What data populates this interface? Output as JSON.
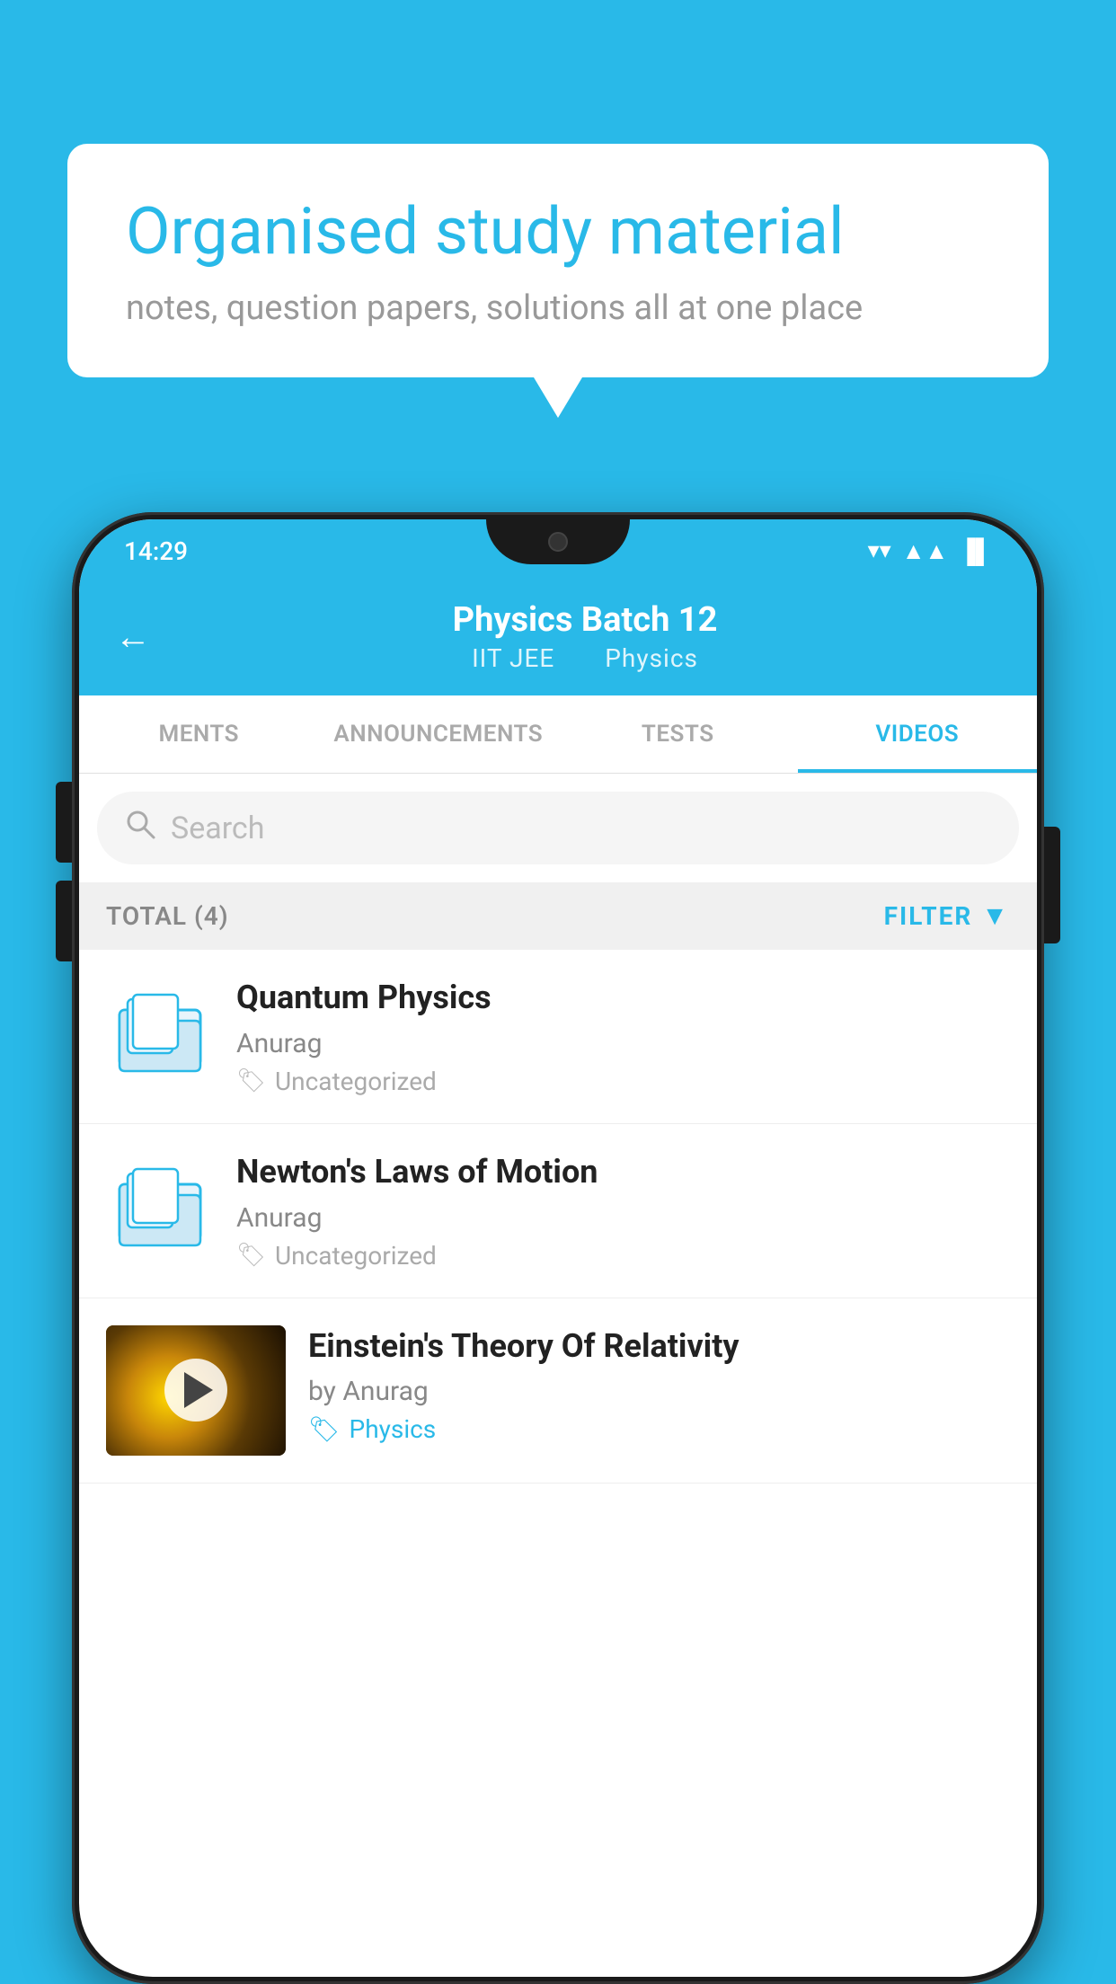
{
  "background_color": "#29b9e8",
  "bubble": {
    "title": "Organised study material",
    "subtitle": "notes, question papers, solutions all at one place"
  },
  "status_bar": {
    "time": "14:29",
    "wifi_icon": "▼",
    "signal_icon": "▲",
    "battery_icon": "▐"
  },
  "app_bar": {
    "title": "Physics Batch 12",
    "subtitle_left": "IIT JEE",
    "subtitle_right": "Physics",
    "back_label": "←"
  },
  "tabs": [
    {
      "id": "ments",
      "label": "MENTS",
      "active": false
    },
    {
      "id": "announcements",
      "label": "ANNOUNCEMENTS",
      "active": false
    },
    {
      "id": "tests",
      "label": "TESTS",
      "active": false
    },
    {
      "id": "videos",
      "label": "VIDEOS",
      "active": true
    }
  ],
  "search": {
    "placeholder": "Search"
  },
  "filter_bar": {
    "total_label": "TOTAL (4)",
    "filter_label": "FILTER"
  },
  "video_items": [
    {
      "id": "quantum-physics",
      "title": "Quantum Physics",
      "author": "Anurag",
      "tag": "Uncategorized",
      "has_thumbnail": false
    },
    {
      "id": "newtons-laws",
      "title": "Newton's Laws of Motion",
      "author": "Anurag",
      "tag": "Uncategorized",
      "has_thumbnail": false
    },
    {
      "id": "einstein-relativity",
      "title": "Einstein's Theory Of Relativity",
      "author": "by Anurag",
      "tag": "Physics",
      "has_thumbnail": true
    }
  ]
}
